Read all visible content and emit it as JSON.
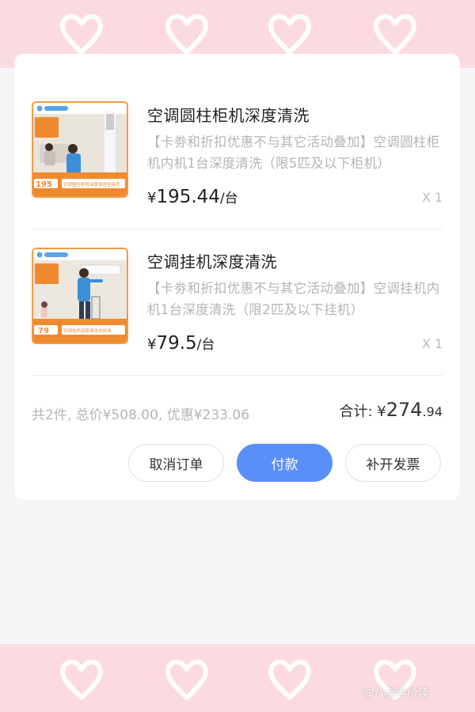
{
  "colors": {
    "band": "#fcdbe0",
    "accent": "#5a8ff7",
    "thumb_border": "#f39a45"
  },
  "order": {
    "items": [
      {
        "title": "空调圆柱柜机深度清洗",
        "desc": "【卡劵和折扣优惠不与其它活动叠加】空调圆柱柜机内机1台深度清洗（限5匹及以下柜机）",
        "price_symbol": "¥",
        "price": "195.44",
        "unit": "/台",
        "qty": "X 1",
        "thumb_price": "195",
        "thumb_caption": "空调圆柱柜机深度清洗全拆洗"
      },
      {
        "title": "空调挂机深度清洗",
        "desc": "【卡劵和折扣优惠不与其它活动叠加】空调挂机内机1台深度清洗（限2匹及以下挂机）",
        "price_symbol": "¥",
        "price": "79.5",
        "unit": "/台",
        "qty": "X 1",
        "thumb_price": "79",
        "thumb_caption": "空调挂机深度清洗全拆洗"
      }
    ],
    "summary": "共2件, 总价¥508.00, 优惠¥233.06",
    "total_label": "合计: ",
    "total_symbol": "¥",
    "total_int": "274",
    "total_dec": ".94"
  },
  "buttons": {
    "cancel": "取消订单",
    "pay": "付款",
    "invoice": "补开发票"
  },
  "watermark": "@八点半微读"
}
